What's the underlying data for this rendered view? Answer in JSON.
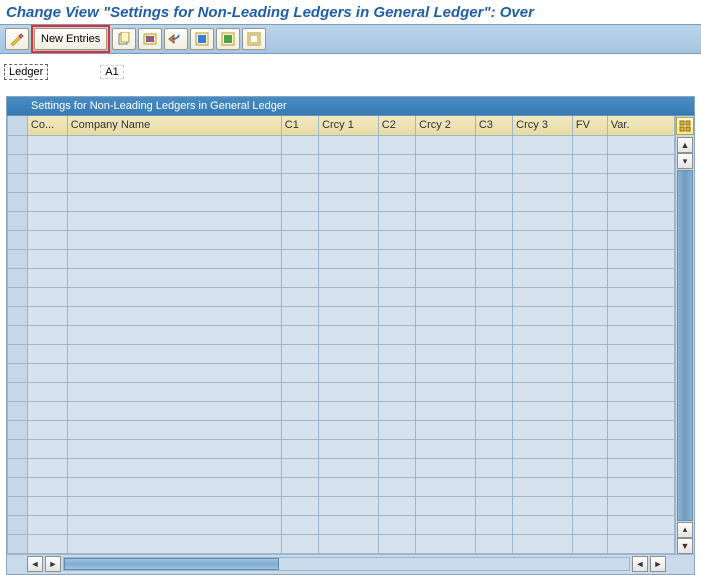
{
  "title": "Change View \"Settings for Non-Leading Ledgers in General Ledger\": Over",
  "toolbar": {
    "new_entries_label": "New Entries"
  },
  "ledger": {
    "label": "Ledger",
    "value": "A1"
  },
  "table": {
    "title": "Settings for Non-Leading Ledgers in General Ledger",
    "columns": [
      "Co...",
      "Company Name",
      "C1",
      "Crcy 1",
      "C2",
      "Crcy 2",
      "C3",
      "Crcy 3",
      "FV",
      "Var."
    ],
    "rows": 22
  }
}
